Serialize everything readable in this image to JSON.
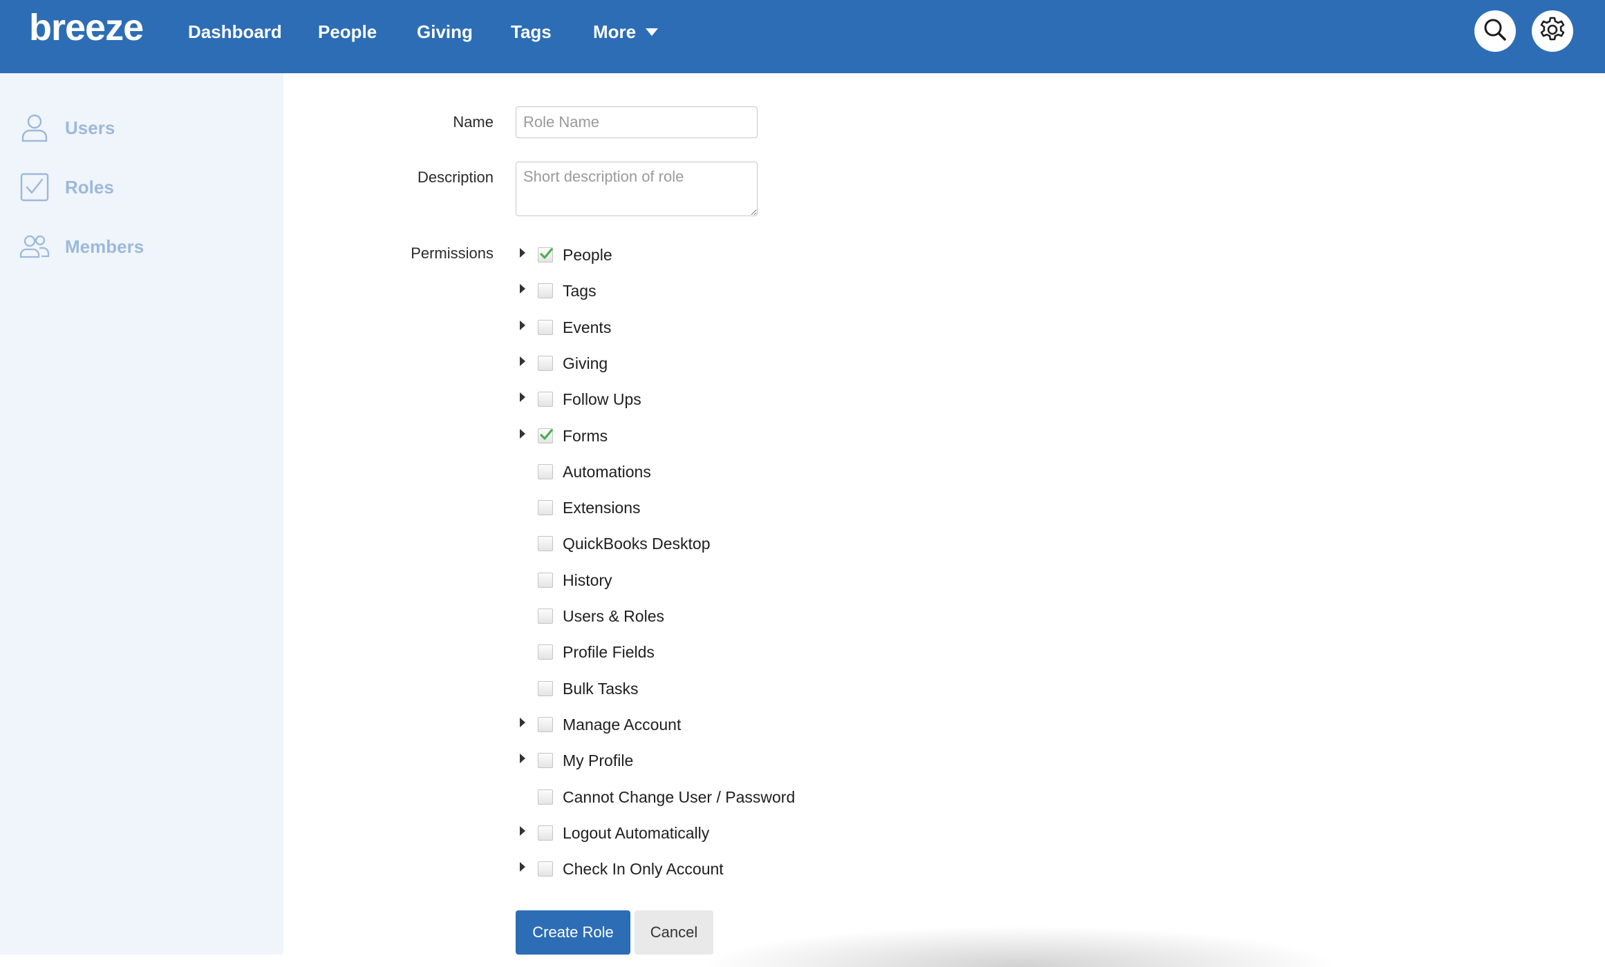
{
  "app": {
    "logo": "breeze"
  },
  "nav": {
    "items": [
      {
        "label": "Dashboard"
      },
      {
        "label": "People"
      },
      {
        "label": "Giving"
      },
      {
        "label": "Tags"
      },
      {
        "label": "More"
      }
    ],
    "search_icon": "search-icon",
    "settings_icon": "gear-icon"
  },
  "sidebar": {
    "items": [
      {
        "label": "Users",
        "icon": "user-icon"
      },
      {
        "label": "Roles",
        "icon": "checkbox-icon"
      },
      {
        "label": "Members",
        "icon": "members-icon"
      }
    ]
  },
  "form": {
    "name_label": "Name",
    "name_placeholder": "Role Name",
    "name_value": "",
    "description_label": "Description",
    "description_placeholder": "Short description of role",
    "description_value": "",
    "permissions_label": "Permissions",
    "permissions": [
      {
        "label": "People",
        "expandable": true,
        "checked": true
      },
      {
        "label": "Tags",
        "expandable": true,
        "checked": false
      },
      {
        "label": "Events",
        "expandable": true,
        "checked": false
      },
      {
        "label": "Giving",
        "expandable": true,
        "checked": false
      },
      {
        "label": "Follow Ups",
        "expandable": true,
        "checked": false
      },
      {
        "label": "Forms",
        "expandable": true,
        "checked": true
      },
      {
        "label": "Automations",
        "expandable": false,
        "checked": false
      },
      {
        "label": "Extensions",
        "expandable": false,
        "checked": false
      },
      {
        "label": "QuickBooks Desktop",
        "expandable": false,
        "checked": false
      },
      {
        "label": "History",
        "expandable": false,
        "checked": false
      },
      {
        "label": "Users & Roles",
        "expandable": false,
        "checked": false
      },
      {
        "label": "Profile Fields",
        "expandable": false,
        "checked": false
      },
      {
        "label": "Bulk Tasks",
        "expandable": false,
        "checked": false
      },
      {
        "label": "Manage Account",
        "expandable": true,
        "checked": false
      },
      {
        "label": "My Profile",
        "expandable": true,
        "checked": false
      },
      {
        "label": "Cannot Change User / Password",
        "expandable": false,
        "checked": false
      },
      {
        "label": "Logout Automatically",
        "expandable": true,
        "checked": false
      },
      {
        "label": "Check In Only Account",
        "expandable": true,
        "checked": false
      }
    ],
    "create_button": "Create Role",
    "cancel_button": "Cancel"
  },
  "colors": {
    "brand": "#2c6db5",
    "sidebar_bg": "#f0f5fb",
    "sidebar_text": "#9cb9db",
    "check_green": "#4caf50"
  }
}
